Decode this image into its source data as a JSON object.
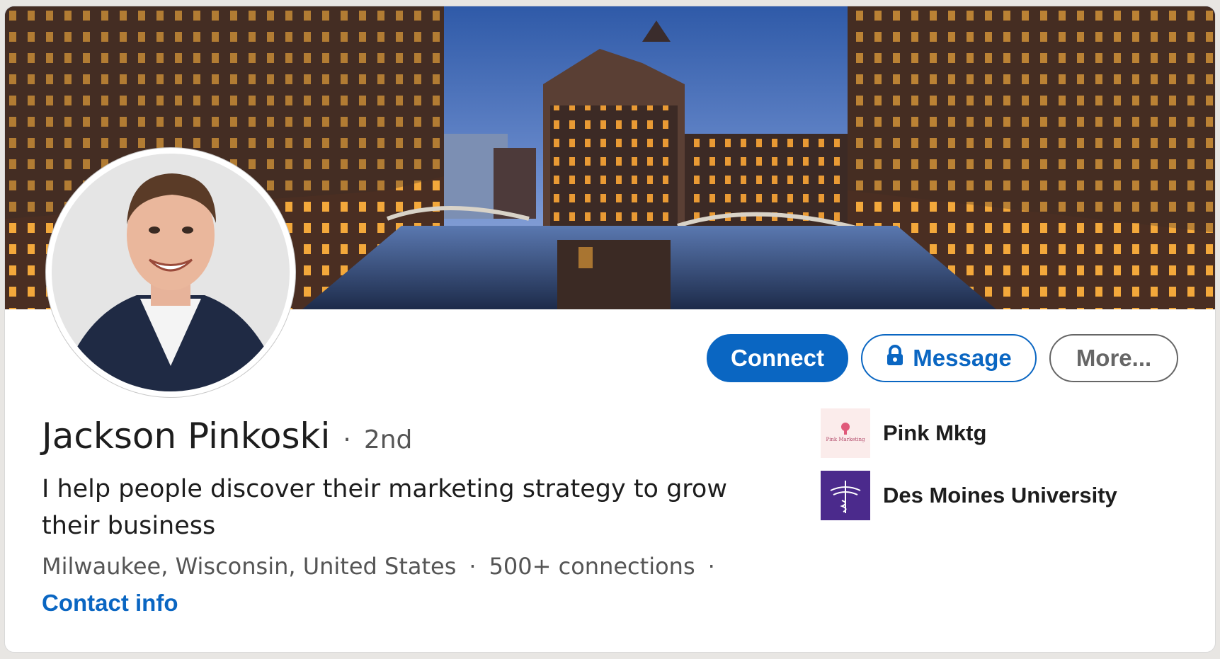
{
  "profile": {
    "name": "Jackson Pinkoski",
    "degree": "2nd",
    "headline": "I help people discover their marketing strategy to grow their business",
    "location": "Milwaukee, Wisconsin, United States",
    "connections": "500+ connections",
    "contact_info": "Contact info"
  },
  "actions": {
    "connect": "Connect",
    "message": "Message",
    "more": "More..."
  },
  "orgs": [
    {
      "name": "Pink Mktg",
      "logo_text": "Pink Marketing",
      "logo_bg": "#fbeceb"
    },
    {
      "name": "Des Moines University",
      "logo_bg": "#4b2a8c"
    }
  ],
  "colors": {
    "accent": "#0a66c2",
    "text": "#1d1d1d",
    "muted": "#555555"
  },
  "icons": {
    "message_button": "lock-icon"
  }
}
